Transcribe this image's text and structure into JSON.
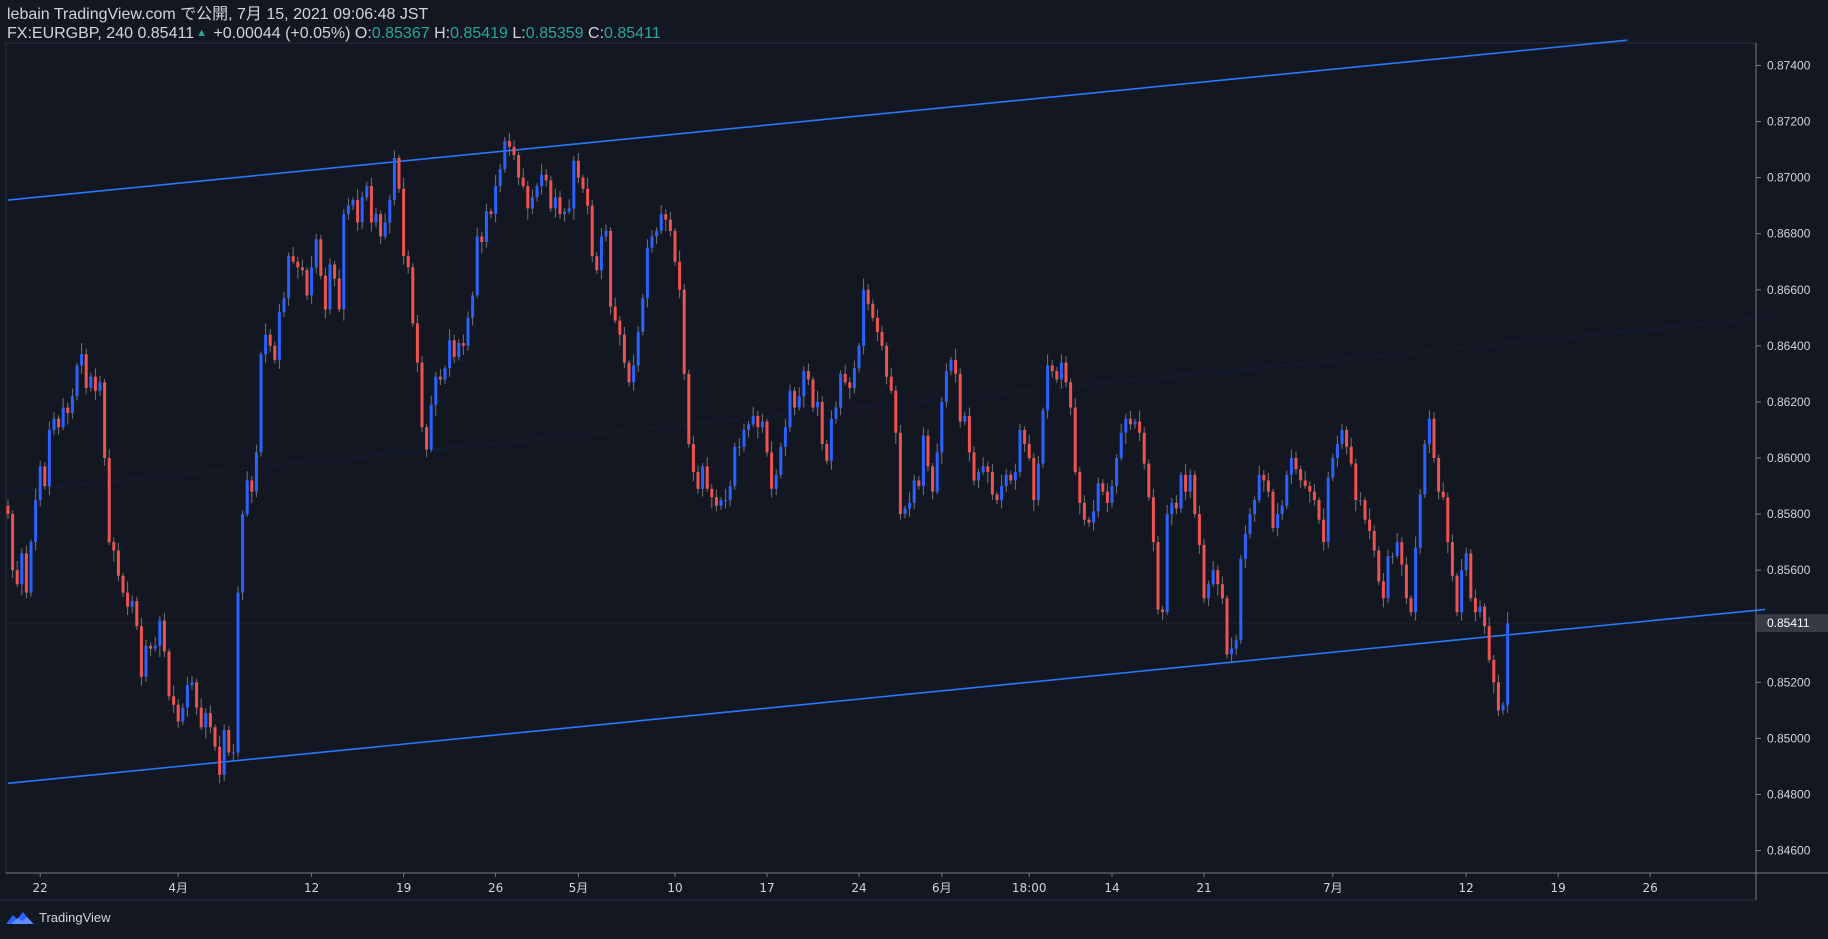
{
  "header": {
    "publish_line": "lebain TradingView.com で公開, 7月 15, 2021 09:06:48 JST",
    "symbol": "FX:EURGBP, 240",
    "last": "0.85411",
    "change": "+0.00044 (+0.05%)",
    "o_label": "O:",
    "o_val": "0.85367",
    "h_label": "H:",
    "h_val": "0.85419",
    "l_label": "L:",
    "l_val": "0.85359",
    "c_label": "C:",
    "c_val": "0.85411"
  },
  "footer": {
    "brand": "TradingView"
  },
  "colors": {
    "background": "#131722",
    "up": "#2962ff",
    "down": "#ef5350",
    "trendline": "#2979ff",
    "text": "#d1d4dc",
    "price_badge": "#363a45"
  },
  "chart_data": {
    "type": "candlestick",
    "symbol": "FX:EURGBP",
    "interval": "240",
    "ylim": [
      0.8452,
      0.8748
    ],
    "y_ticks": [
      "0.84600",
      "0.84800",
      "0.85000",
      "0.85200",
      "0.85400",
      "0.85600",
      "0.85800",
      "0.86000",
      "0.86200",
      "0.86400",
      "0.86600",
      "0.86800",
      "0.87000",
      "0.87200",
      "0.87400"
    ],
    "last_price_label": "0.85411",
    "last_price": 0.85411,
    "x_ticks": [
      "22",
      "4月",
      "12",
      "19",
      "26",
      "5月",
      "10",
      "17",
      "24",
      "6月",
      "18:00",
      "14",
      "21",
      "7月",
      "12",
      "19",
      "26"
    ],
    "x_tick_index": [
      7,
      37,
      66,
      86,
      106,
      124,
      145,
      165,
      185,
      203,
      222,
      240,
      260,
      288,
      317,
      337,
      357
    ],
    "trendlines": [
      {
        "name": "upper-channel",
        "from": [
          0,
          0.8692
        ],
        "to": [
          352,
          0.8749
        ]
      },
      {
        "name": "lower-channel",
        "from": [
          0,
          0.8484
        ],
        "to": [
          382,
          0.8546
        ]
      },
      {
        "name": "mid-channel",
        "from": [
          0,
          0.8588
        ],
        "to": [
          382,
          0.865
        ],
        "style": "dotted"
      }
    ],
    "close_series": [
      0.858,
      0.856,
      0.8555,
      0.8566,
      0.8552,
      0.857,
      0.8585,
      0.8597,
      0.859,
      0.861,
      0.8614,
      0.8611,
      0.8618,
      0.8616,
      0.8622,
      0.8633,
      0.8637,
      0.8625,
      0.8629,
      0.8624,
      0.8627,
      0.86,
      0.857,
      0.8567,
      0.8558,
      0.8552,
      0.8547,
      0.8549,
      0.854,
      0.8522,
      0.8533,
      0.8532,
      0.8533,
      0.8542,
      0.8531,
      0.8515,
      0.8512,
      0.8506,
      0.8511,
      0.8519,
      0.852,
      0.8511,
      0.8504,
      0.8509,
      0.8504,
      0.8497,
      0.8487,
      0.8503,
      0.8495,
      0.8495,
      0.8552,
      0.858,
      0.8592,
      0.8588,
      0.8602,
      0.8637,
      0.8644,
      0.864,
      0.8635,
      0.8652,
      0.8657,
      0.8672,
      0.867,
      0.8668,
      0.8667,
      0.8658,
      0.8668,
      0.8678,
      0.8665,
      0.8653,
      0.8669,
      0.8664,
      0.8653,
      0.8687,
      0.869,
      0.8692,
      0.8684,
      0.8693,
      0.8697,
      0.8684,
      0.8687,
      0.8679,
      0.8684,
      0.8692,
      0.8707,
      0.8696,
      0.8672,
      0.8668,
      0.8648,
      0.8634,
      0.8611,
      0.8603,
      0.8619,
      0.8629,
      0.8628,
      0.8632,
      0.8642,
      0.8636,
      0.8641,
      0.864,
      0.865,
      0.8658,
      0.8679,
      0.8677,
      0.8688,
      0.8687,
      0.8697,
      0.8703,
      0.8713,
      0.8711,
      0.8708,
      0.87,
      0.8697,
      0.8689,
      0.8693,
      0.8697,
      0.8701,
      0.8699,
      0.8689,
      0.8693,
      0.8687,
      0.8688,
      0.8689,
      0.8706,
      0.87,
      0.8696,
      0.869,
      0.8672,
      0.8667,
      0.8679,
      0.8681,
      0.8654,
      0.8649,
      0.8644,
      0.8634,
      0.8627,
      0.8633,
      0.8645,
      0.8657,
      0.8675,
      0.8679,
      0.8681,
      0.8687,
      0.8685,
      0.8681,
      0.867,
      0.866,
      0.863,
      0.8605,
      0.8595,
      0.8589,
      0.8597,
      0.8589,
      0.8586,
      0.8583,
      0.8585,
      0.8585,
      0.859,
      0.8604,
      0.8604,
      0.861,
      0.8612,
      0.8615,
      0.8611,
      0.8613,
      0.8602,
      0.8589,
      0.8594,
      0.8604,
      0.8611,
      0.8624,
      0.8618,
      0.8622,
      0.8631,
      0.8628,
      0.8618,
      0.862,
      0.8605,
      0.8599,
      0.8614,
      0.8618,
      0.863,
      0.8627,
      0.8625,
      0.8632,
      0.864,
      0.866,
      0.8655,
      0.865,
      0.8645,
      0.864,
      0.8629,
      0.8624,
      0.8609,
      0.858,
      0.8582,
      0.8584,
      0.8592,
      0.859,
      0.8608,
      0.8597,
      0.8588,
      0.8602,
      0.862,
      0.8631,
      0.8635,
      0.863,
      0.8613,
      0.8615,
      0.8602,
      0.8592,
      0.8595,
      0.8597,
      0.8595,
      0.8587,
      0.8585,
      0.859,
      0.8594,
      0.8592,
      0.8595,
      0.861,
      0.8605,
      0.86,
      0.8585,
      0.8598,
      0.8617,
      0.8633,
      0.8631,
      0.8628,
      0.8634,
      0.8627,
      0.8618,
      0.8595,
      0.8584,
      0.8578,
      0.8577,
      0.8581,
      0.8591,
      0.8588,
      0.8584,
      0.859,
      0.86,
      0.8609,
      0.8614,
      0.8612,
      0.8613,
      0.8609,
      0.8598,
      0.8586,
      0.857,
      0.8546,
      0.8545,
      0.858,
      0.8584,
      0.8582,
      0.8594,
      0.8588,
      0.8594,
      0.858,
      0.8569,
      0.855,
      0.8555,
      0.856,
      0.8555,
      0.855,
      0.853,
      0.8532,
      0.8535,
      0.8564,
      0.8573,
      0.858,
      0.8585,
      0.8594,
      0.8592,
      0.8588,
      0.8575,
      0.858,
      0.8583,
      0.8594,
      0.86,
      0.8596,
      0.8592,
      0.859,
      0.8588,
      0.8585,
      0.8578,
      0.857,
      0.8593,
      0.86,
      0.8605,
      0.861,
      0.8604,
      0.8598,
      0.8585,
      0.8585,
      0.8578,
      0.8574,
      0.8567,
      0.8556,
      0.855,
      0.8565,
      0.8565,
      0.857,
      0.8562,
      0.855,
      0.8545,
      0.8568,
      0.8587,
      0.8605,
      0.8614,
      0.86,
      0.8588,
      0.8586,
      0.857,
      0.8558,
      0.8545,
      0.856,
      0.8566,
      0.855,
      0.8545,
      0.8547,
      0.854,
      0.8528,
      0.852,
      0.851,
      0.8512,
      0.8541
    ]
  }
}
